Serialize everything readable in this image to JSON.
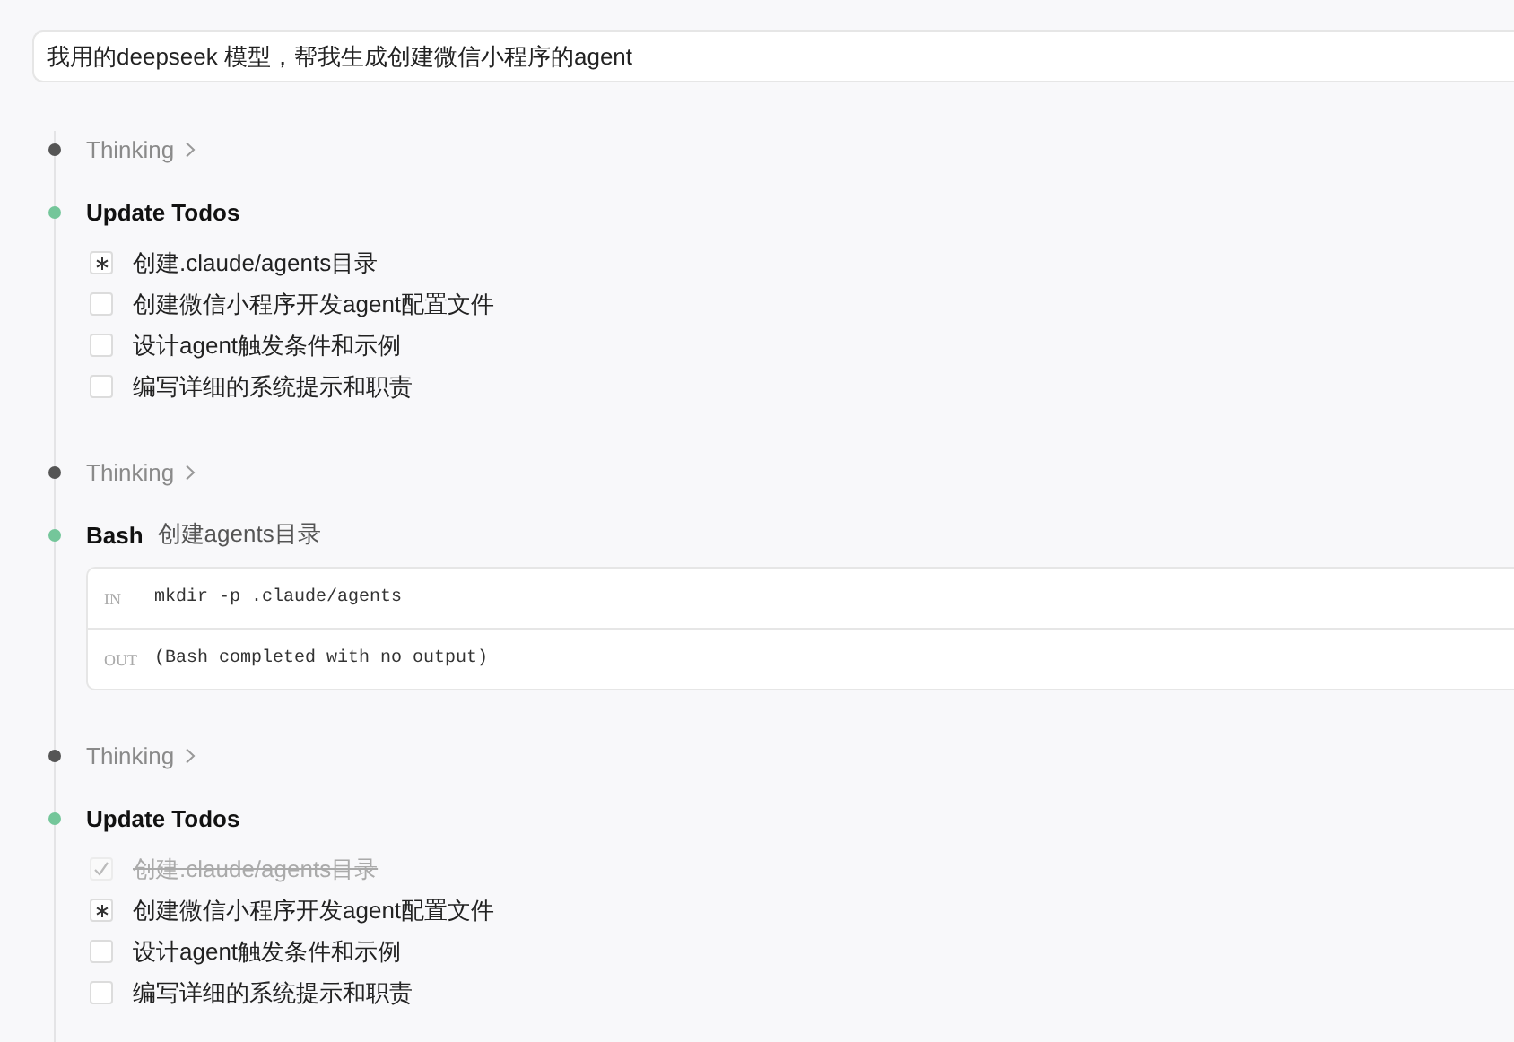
{
  "prompt": {
    "value": "我用的deepseek 模型，帮我生成创建微信小程序的agent"
  },
  "steps": [
    {
      "kind": "thinking",
      "label": "Thinking",
      "expanded": false
    },
    {
      "kind": "todos",
      "title": "Update Todos",
      "todos": [
        {
          "text": "创建.claude/agents目录",
          "checked": false,
          "active": true
        },
        {
          "text": "创建微信小程序开发agent配置文件",
          "checked": false,
          "active": false
        },
        {
          "text": "设计agent触发条件和示例",
          "checked": false,
          "active": false
        },
        {
          "text": "编写详细的系统提示和职责",
          "checked": false,
          "active": false
        }
      ]
    },
    {
      "kind": "thinking",
      "label": "Thinking",
      "expanded": false
    },
    {
      "kind": "bash",
      "title": "Bash",
      "description": "创建agents目录",
      "in_label": "IN",
      "command": "mkdir -p .claude/agents",
      "out_label": "OUT",
      "output": "(Bash completed with no output)"
    },
    {
      "kind": "thinking",
      "label": "Thinking",
      "expanded": false
    },
    {
      "kind": "todos",
      "title": "Update Todos",
      "todos": [
        {
          "text": "创建.claude/agents目录",
          "checked": true,
          "active": false
        },
        {
          "text": "创建微信小程序开发agent配置文件",
          "checked": false,
          "active": true
        },
        {
          "text": "设计agent触发条件和示例",
          "checked": false,
          "active": false
        },
        {
          "text": "编写详细的系统提示和职责",
          "checked": false,
          "active": false
        }
      ]
    }
  ]
}
